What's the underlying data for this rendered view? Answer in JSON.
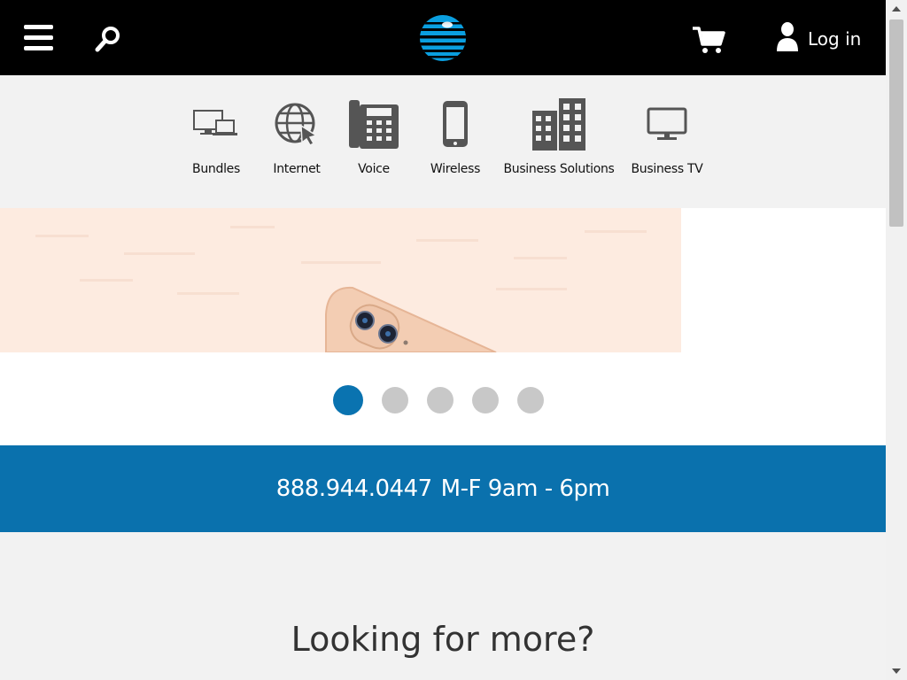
{
  "header": {
    "menu_icon": "hamburger-menu-icon",
    "search_icon": "search-icon",
    "logo_icon": "att-globe-logo",
    "cart_icon": "shopping-cart-icon",
    "user_icon": "user-icon",
    "login_label": "Log in"
  },
  "categories": [
    {
      "label": "Bundles",
      "icon": "devices-icon"
    },
    {
      "label": "Internet",
      "icon": "globe-cursor-icon"
    },
    {
      "label": "Voice",
      "icon": "desk-phone-icon"
    },
    {
      "label": "Wireless",
      "icon": "smartphone-icon"
    },
    {
      "label": "Business Solutions",
      "icon": "building-icon"
    },
    {
      "label": "Business TV",
      "icon": "monitor-icon"
    }
  ],
  "carousel": {
    "slide_count": 5,
    "active_index": 0
  },
  "phone_banner": {
    "number": "888.944.0447",
    "hours": "M-F 9am - 6pm"
  },
  "more_section": {
    "title": "Looking for more?"
  },
  "colors": {
    "header_bg": "#000000",
    "brand_blue": "#0a71ad",
    "logo_blue": "#0a9fe0",
    "nav_bg": "#f2f2f2",
    "icon_gray": "#555555",
    "dot_inactive": "#c8c8c8",
    "hero_bg": "#fdebe0"
  }
}
